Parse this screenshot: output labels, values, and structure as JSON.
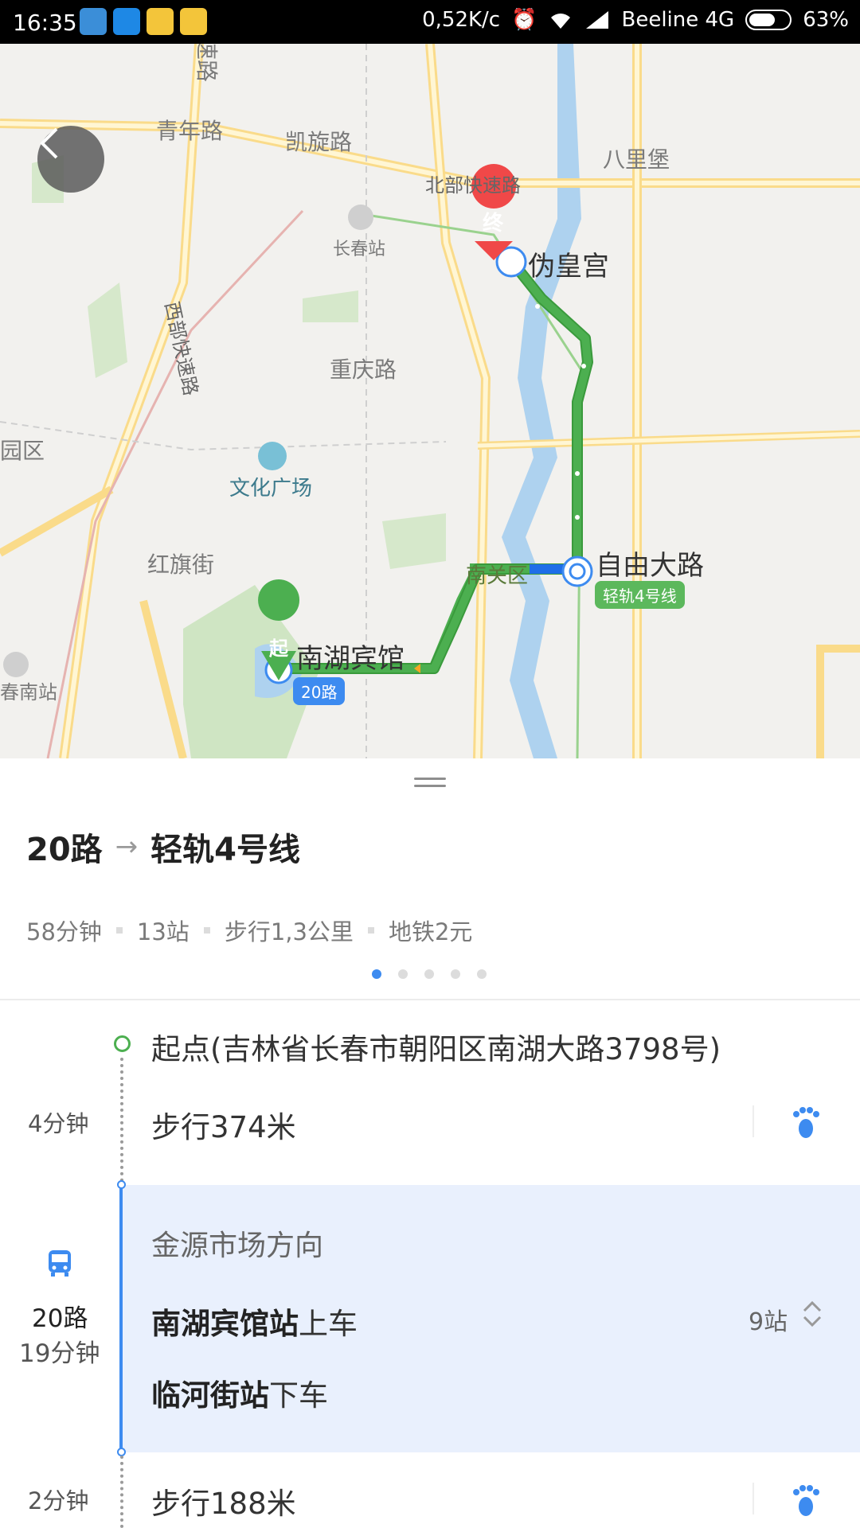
{
  "status_bar": {
    "time": "16:35",
    "network_speed": "0,52K/c",
    "carrier": "Beeline 4G",
    "battery": "63%",
    "battery_level": 0.63,
    "app_icons": [
      "weather-app-icon",
      "translate-app-icon",
      "map-app-icon",
      "map-app-icon-2"
    ]
  },
  "map": {
    "labels": {
      "qingnian_road": "青年路",
      "kaixuan_road": "凯旋路",
      "beibu_expressway": "北部快速路",
      "balibao": "八里堡",
      "changchun_station": "长春站",
      "xibu_expressway": "西部快速路",
      "chongqing_road": "重庆路",
      "wenhua_square": "文化广场",
      "hongqi_street": "红旗街",
      "nanguan_district": "南关区",
      "changchun_south_station": "春南站",
      "district_fragment": "园区",
      "top_road_fragment": "速路"
    },
    "start_marker": "起",
    "end_marker": "终",
    "start_stop": "南湖宾馆",
    "bus_badge": "20路",
    "transfer_stop": "自由大路",
    "rail_badge": "轻轨4号线",
    "end_stop": "伪皇宫",
    "colors": {
      "route_green": "#4caf50",
      "route_blue": "#1e6ee8",
      "end_marker": "#f04848",
      "start_marker": "#4caf50"
    }
  },
  "sheet": {
    "route": {
      "bus": "20路",
      "arrow": "→",
      "rail": "轻轨4号线"
    },
    "meta": {
      "duration": "58分钟",
      "stops": "13站",
      "walk": "步行1,3公里",
      "fare": "地铁2元"
    },
    "pager": {
      "count": 5,
      "active": 0
    },
    "steps": {
      "start": "起点(吉林省长春市朝阳区南湖大路3798号)",
      "walk1_time": "4分钟",
      "walk1": "步行374米",
      "bus_line": "20路",
      "bus_time": "19分钟",
      "direction": "金源市场方向",
      "board_station": "南湖宾馆站",
      "board_suffix": "上车",
      "alight_station": "临河街站",
      "alight_suffix": "下车",
      "stop_count": "9站",
      "walk2_time": "2分钟",
      "walk2": "步行188米"
    },
    "colors": {
      "accent": "#3d8bf0",
      "bus_block_bg": "#e9f0fd"
    }
  }
}
